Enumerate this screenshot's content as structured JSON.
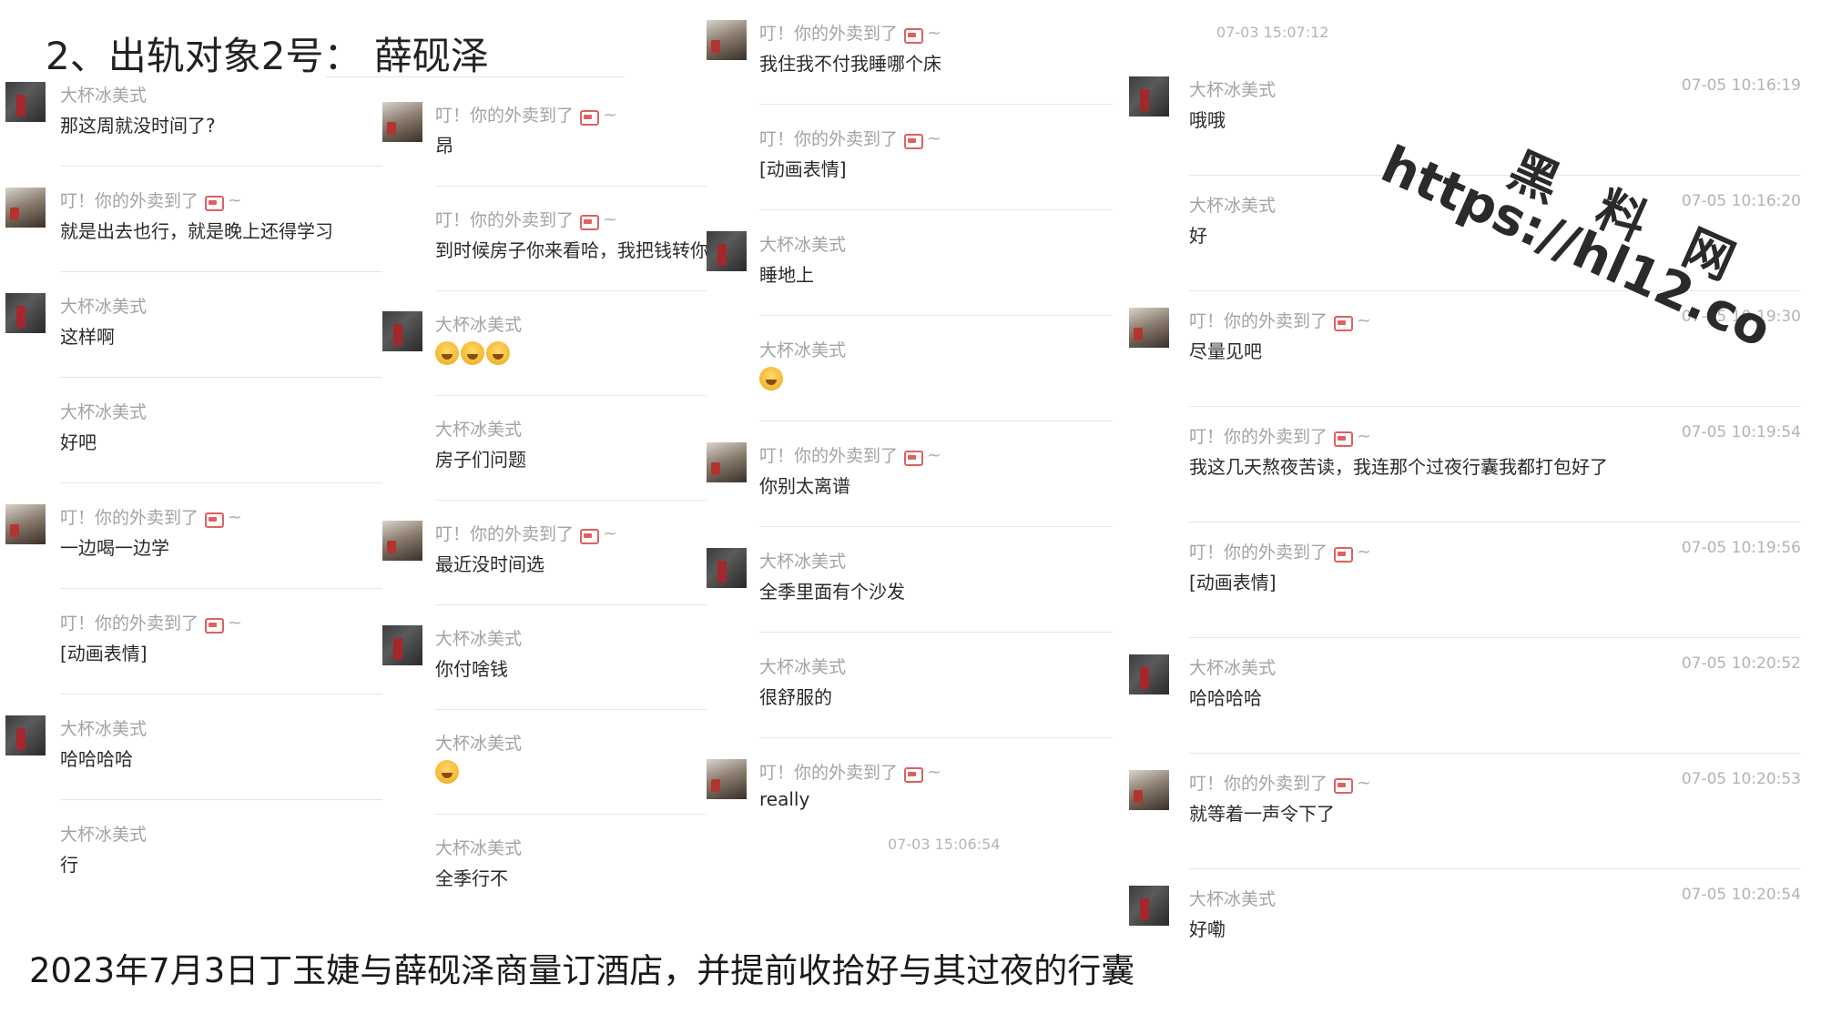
{
  "slide": {
    "title": "2、出轨对象2号：  薛砚泽",
    "caption": "2023年7月3日丁玉婕与薛砚泽商量订酒店，并提前收拾好与其过夜的行囊"
  },
  "watermark": {
    "cn": "黑 料 网",
    "url": "https://hl12.co"
  },
  "columns": [
    {
      "messages": [
        {
          "avatar": "dark",
          "sender": "大杯冰美式",
          "delivery": false,
          "text": "那这周就没时间了?"
        },
        {
          "avatar": "girl",
          "sender": "叮！你的外卖到了",
          "delivery": true,
          "text": "就是出去也行，就是晚上还得学习"
        },
        {
          "avatar": "dark",
          "sender": "大杯冰美式",
          "delivery": false,
          "text": "这样啊"
        },
        {
          "avatar": "none",
          "sender": "大杯冰美式",
          "delivery": false,
          "text": "好吧"
        },
        {
          "avatar": "girl",
          "sender": "叮！你的外卖到了",
          "delivery": true,
          "text": "一边喝一边学"
        },
        {
          "avatar": "none",
          "sender": "叮！你的外卖到了",
          "delivery": true,
          "text": "[动画表情]"
        },
        {
          "avatar": "dark",
          "sender": "大杯冰美式",
          "delivery": false,
          "text": "哈哈哈哈"
        },
        {
          "avatar": "none",
          "sender": "大杯冰美式",
          "delivery": false,
          "text": "行"
        }
      ]
    },
    {
      "messages": [
        {
          "avatar": "girl",
          "sender": "叮！你的外卖到了",
          "delivery": true,
          "text": "昂"
        },
        {
          "avatar": "none",
          "sender": "叮！你的外卖到了",
          "delivery": true,
          "text": "到时候房子你来看哈，我把钱转你"
        },
        {
          "avatar": "dark",
          "sender": "大杯冰美式",
          "delivery": false,
          "text": "",
          "emoji_count": 3
        },
        {
          "avatar": "none",
          "sender": "大杯冰美式",
          "delivery": false,
          "text": "房子们问题"
        },
        {
          "avatar": "girl",
          "sender": "叮！你的外卖到了",
          "delivery": true,
          "text": "最近没时间选"
        },
        {
          "avatar": "dark",
          "sender": "大杯冰美式",
          "delivery": false,
          "text": "你付啥钱"
        },
        {
          "avatar": "none",
          "sender": "大杯冰美式",
          "delivery": false,
          "text": "",
          "emoji_count": 1
        },
        {
          "avatar": "none",
          "sender": "大杯冰美式",
          "delivery": false,
          "text": "全季行不"
        }
      ]
    },
    {
      "messages": [
        {
          "avatar": "girl",
          "sender": "叮！你的外卖到了",
          "delivery": true,
          "text": "我住我不付我睡哪个床"
        },
        {
          "avatar": "none",
          "sender": "叮！你的外卖到了",
          "delivery": true,
          "text": "[动画表情]"
        },
        {
          "avatar": "dark",
          "sender": "大杯冰美式",
          "delivery": false,
          "text": "睡地上"
        },
        {
          "avatar": "none",
          "sender": "大杯冰美式",
          "delivery": false,
          "text": "",
          "emoji_count": 1
        },
        {
          "avatar": "girl",
          "sender": "叮！你的外卖到了",
          "delivery": true,
          "text": "你别太离谱"
        },
        {
          "avatar": "dark",
          "sender": "大杯冰美式",
          "delivery": false,
          "text": "全季里面有个沙发"
        },
        {
          "avatar": "none",
          "sender": "大杯冰美式",
          "delivery": false,
          "text": "很舒服的"
        },
        {
          "avatar": "girl",
          "sender": "叮！你的外卖到了",
          "delivery": true,
          "text": "really"
        }
      ],
      "footer_time": "07-03 15:06:54"
    },
    {
      "header_time": "07-03 15:07:12",
      "messages": [
        {
          "avatar": "dark",
          "sender": "大杯冰美式",
          "delivery": false,
          "text": "哦哦",
          "time": "07-05 10:16:19"
        },
        {
          "avatar": "none",
          "sender": "大杯冰美式",
          "delivery": false,
          "text": "好",
          "time": "07-05 10:16:20"
        },
        {
          "avatar": "girl",
          "sender": "叮！你的外卖到了",
          "delivery": true,
          "text": "尽量见吧",
          "time": "07-05 10:19:30"
        },
        {
          "avatar": "none",
          "sender": "叮！你的外卖到了",
          "delivery": true,
          "text": "我这几天熬夜苦读，我连那个过夜行囊我都打包好了",
          "time": "07-05 10:19:54"
        },
        {
          "avatar": "none",
          "sender": "叮！你的外卖到了",
          "delivery": true,
          "text": "[动画表情]",
          "time": "07-05 10:19:56"
        },
        {
          "avatar": "dark",
          "sender": "大杯冰美式",
          "delivery": false,
          "text": "哈哈哈哈",
          "time": "07-05 10:20:52"
        },
        {
          "avatar": "girl",
          "sender": "叮！你的外卖到了",
          "delivery": true,
          "text": "就等着一声令下了",
          "time": "07-05 10:20:53"
        },
        {
          "avatar": "dark",
          "sender": "大杯冰美式",
          "delivery": false,
          "text": "好嘞",
          "time": "07-05 10:20:54"
        }
      ]
    }
  ]
}
